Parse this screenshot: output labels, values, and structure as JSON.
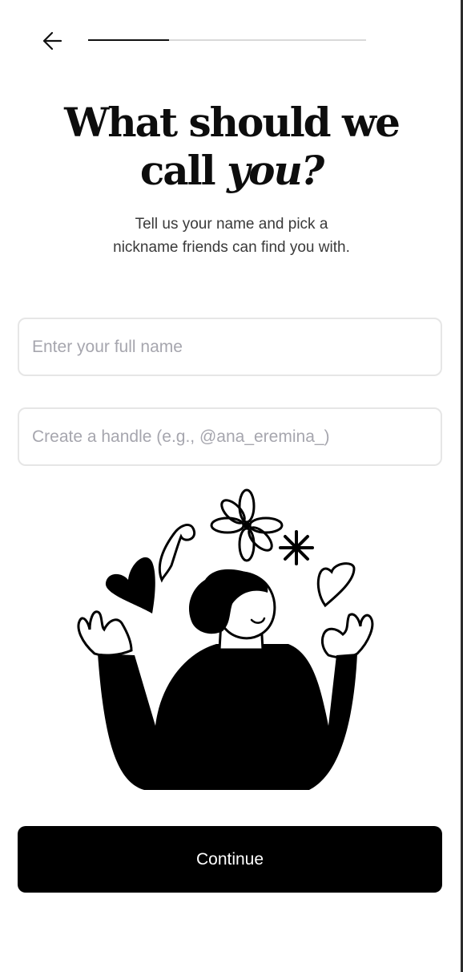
{
  "nav": {
    "back_icon": "arrow-left-icon",
    "progress": 0.29
  },
  "heading": {
    "line1": "What should we",
    "line2_prefix": "call",
    "line2_accent": "you?"
  },
  "subtitle": {
    "line1": "Tell us your name and pick a",
    "line2": "nickname friends can find you with."
  },
  "form": {
    "full_name": {
      "value": "",
      "placeholder": "Enter your full name"
    },
    "handle": {
      "value": "",
      "placeholder": "Create a handle (e.g., @ana_eremina_)"
    }
  },
  "illustration": {
    "icon": "person-juggling-doodles-illustration"
  },
  "actions": {
    "continue_label": "Continue"
  },
  "colors": {
    "primary": "#000000",
    "background": "#ffffff",
    "field_border": "#e6e6e6",
    "placeholder": "#a6a6ae",
    "progress_track": "#d9d9d9"
  }
}
